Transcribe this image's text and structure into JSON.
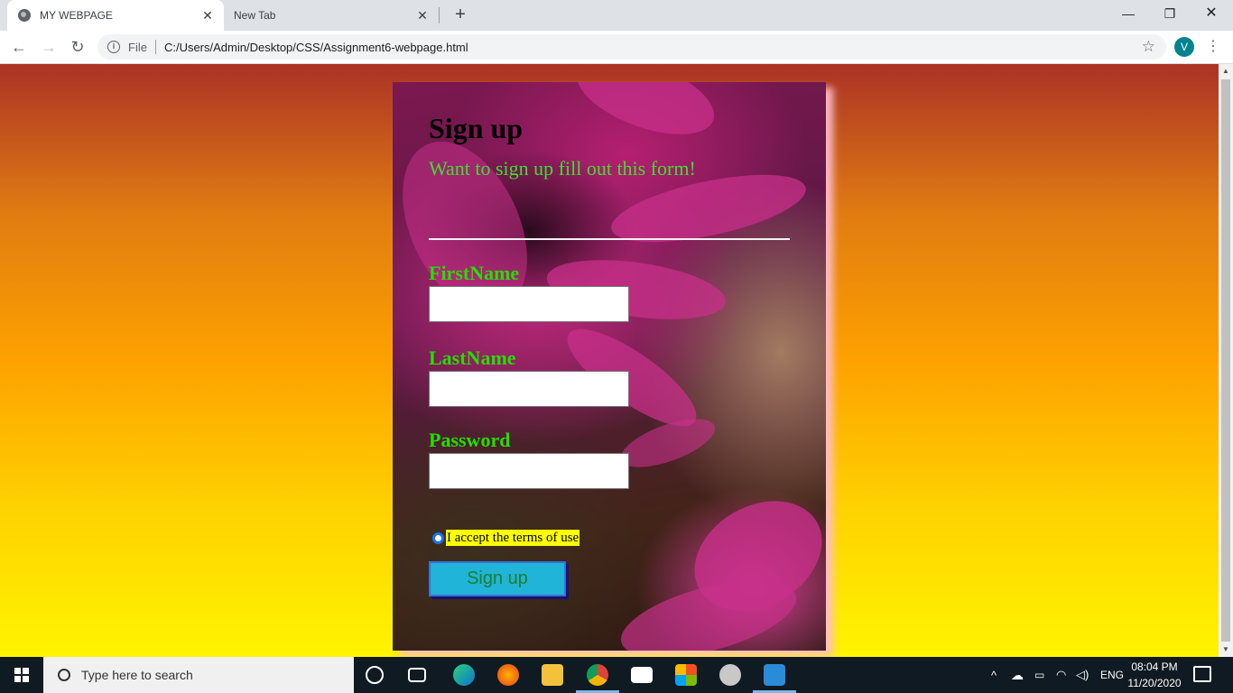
{
  "browser": {
    "tabs": [
      {
        "title": "MY WEBPAGE",
        "active": true
      },
      {
        "title": "New Tab",
        "active": false
      }
    ],
    "new_tab": "+",
    "omnibox": {
      "scheme_label": "File",
      "url": "C:/Users/Admin/Desktop/CSS/Assignment6-webpage.html"
    },
    "profile_initial": "V"
  },
  "page": {
    "heading": "Sign up",
    "subtitle": "Want to sign up fill out this form!",
    "fields": [
      {
        "label": "FirstName",
        "value": ""
      },
      {
        "label": "LastName",
        "value": ""
      },
      {
        "label": "Password",
        "value": ""
      }
    ],
    "terms_label": "I accept the terms of use",
    "terms_checked": true,
    "submit_label": "Sign up",
    "colors": {
      "heading": "#000000",
      "subtitle": "#3ddf2f",
      "labels": "#22e000",
      "terms_highlight": "#ffff00",
      "button": "#1fb4d8"
    }
  },
  "taskbar": {
    "search_placeholder": "Type here to search",
    "language": "ENG",
    "time": "08:04 PM",
    "date": "11/20/2020"
  }
}
